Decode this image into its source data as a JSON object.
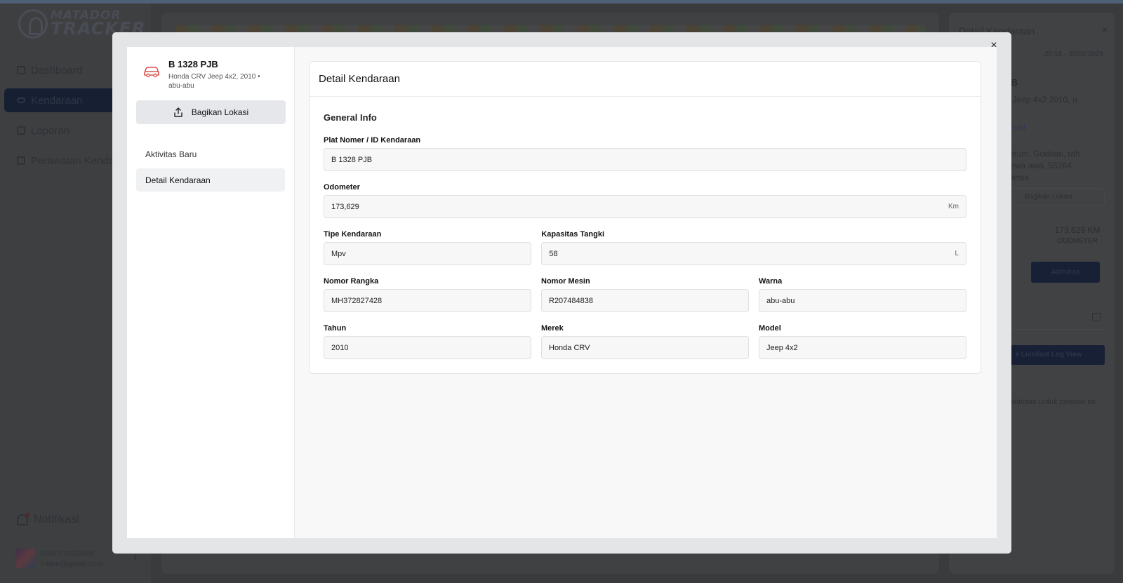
{
  "app": {
    "logo_line1": "MATADOR",
    "logo_line2": "TRACKER"
  },
  "sidebar": {
    "items": [
      {
        "label": "Dashboard"
      },
      {
        "label": "Kendaraan"
      },
      {
        "label": "Laporan"
      },
      {
        "label": "Perawatan Kendaraan"
      }
    ],
    "notifications_label": "Notifikasi",
    "user": {
      "name": "intern matador",
      "email": "intern@gmail.com"
    }
  },
  "right_panel": {
    "title": "Detail Kendaraan",
    "timestamp": "20:16 - 30/04/2026",
    "plate": "8 PJB",
    "desc": "CRV Jeep 4x2 2010, u",
    "profile_link": "gi ke Profil",
    "address": "Sidoarum, Godean, rah Istimewa awa, 55264, Indonesia",
    "share_label": "Bagikan Lokasi",
    "odometer_value": "173,629 KM",
    "odometer_label": "ODOMETER",
    "activity_button": "Aktivitas",
    "live_button": "e Live/last Log View",
    "empty_text": "a aktivitas untuk periode ini"
  },
  "modal": {
    "vehicle": {
      "plate": "B 1328 PJB",
      "subtitle": "Honda CRV Jeep 4x2, 2010 • abu-abu"
    },
    "share_button": "Bagikan Lokasi",
    "menu": [
      {
        "label": "Aktivitas Baru"
      },
      {
        "label": "Detail Kendaraan"
      }
    ],
    "card_title": "Detail Kendaraan",
    "section_title": "General Info",
    "fields": {
      "plate": {
        "label": "Plat Nomer / ID Kendaraan",
        "value": "B 1328 PJB"
      },
      "odometer": {
        "label": "Odometer",
        "value": "173,629",
        "unit": "Km"
      },
      "type": {
        "label": "Tipe Kendaraan",
        "value": "Mpv"
      },
      "tank": {
        "label": "Kapasitas Tangki",
        "value": "58",
        "unit": "L"
      },
      "chassis": {
        "label": "Nomor Rangka",
        "value": "MH372827428"
      },
      "engine": {
        "label": "Nomor Mesin",
        "value": "R207484838"
      },
      "color": {
        "label": "Warna",
        "value": "abu-abu"
      },
      "year": {
        "label": "Tahun",
        "value": "2010"
      },
      "brand": {
        "label": "Merek",
        "value": "Honda CRV"
      },
      "model": {
        "label": "Model",
        "value": "Jeep 4x2"
      }
    }
  },
  "colors": {
    "overlay_bg": "#3a3b3d",
    "modal_bg": "#e4e5e7",
    "accent_red": "#d9534f",
    "active_nav": "#172033"
  },
  "icons": [
    "car-icon",
    "share-icon",
    "close-icon",
    "bell-icon",
    "calendar-icon",
    "dashboard-icon"
  ]
}
